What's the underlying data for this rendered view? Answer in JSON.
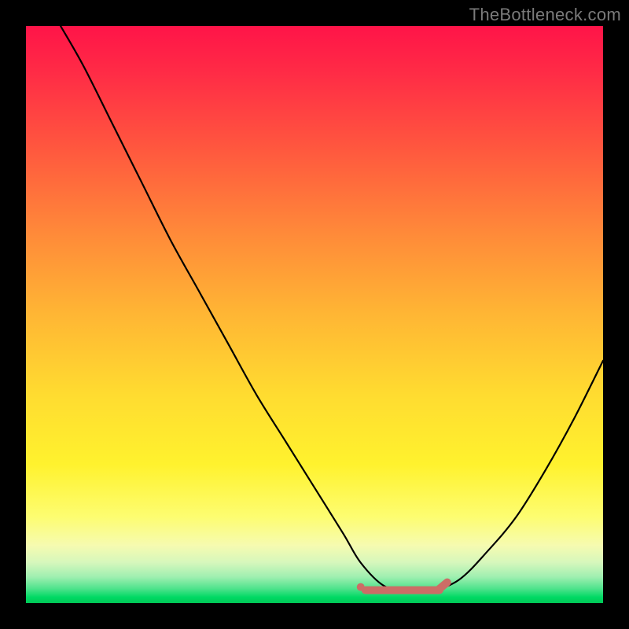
{
  "watermark": "TheBottleneck.com",
  "colors": {
    "curve": "#000000",
    "marker": "#cc6d66",
    "frame": "#000000"
  },
  "chart_data": {
    "type": "line",
    "title": "",
    "xlabel": "",
    "ylabel": "",
    "xlim": [
      0,
      100
    ],
    "ylim": [
      0,
      100
    ],
    "series": [
      {
        "name": "bottleneck-curve",
        "x": [
          6,
          10,
          15,
          20,
          25,
          30,
          35,
          40,
          45,
          50,
          55,
          58,
          62,
          66,
          70,
          75,
          80,
          85,
          90,
          95,
          100
        ],
        "y": [
          100,
          93,
          83,
          73,
          63,
          54,
          45,
          36,
          28,
          20,
          12,
          7,
          3,
          2,
          2,
          4,
          9,
          15,
          23,
          32,
          42
        ]
      }
    ],
    "annotations": [
      {
        "name": "valley-marker",
        "type": "segment",
        "x": [
          58,
          73
        ],
        "y": [
          2.5,
          2.5
        ],
        "color": "#cc6d66"
      }
    ]
  }
}
